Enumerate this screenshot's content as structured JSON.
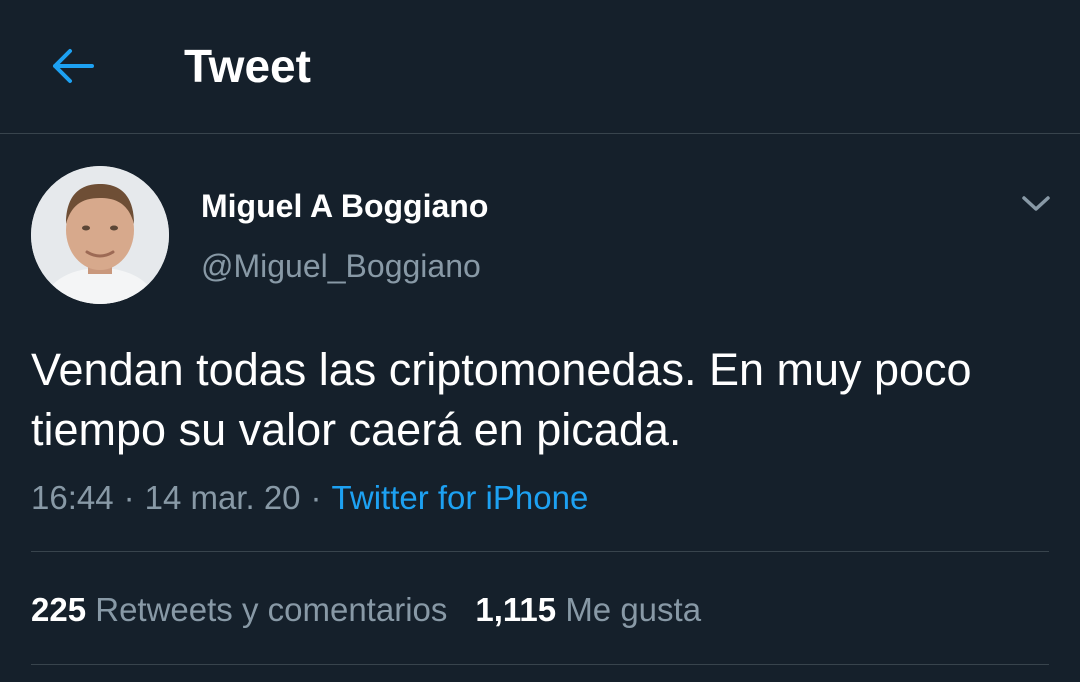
{
  "header": {
    "title": "Tweet",
    "back_icon": "arrow-left-icon"
  },
  "author": {
    "display_name": "Miguel A Boggiano",
    "handle": "@Miguel_Boggiano",
    "avatar_icon": "profile-photo"
  },
  "tweet": {
    "text": "Vendan todas las criptomonedas. En muy poco tiempo su valor caerá en picada.",
    "time": "16:44",
    "date": "14 mar. 20",
    "separator": "·",
    "source": "Twitter for iPhone",
    "menu_icon": "chevron-down-icon"
  },
  "stats": {
    "retweets_count": "225",
    "retweets_label": "Retweets y comentarios",
    "likes_count": "1,115",
    "likes_label": "Me gusta"
  },
  "colors": {
    "background": "#15202b",
    "accent": "#1da1f2",
    "secondary_text": "#8899a6",
    "divider": "#38444d"
  }
}
